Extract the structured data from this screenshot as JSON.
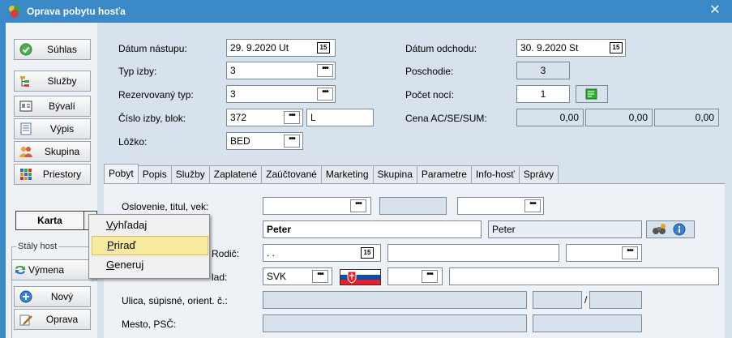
{
  "window": {
    "title": "Oprava pobytu hosťa",
    "close_glyph": "✕"
  },
  "left_buttons": {
    "suhlas": "Súhlas",
    "sluzby": "Služby",
    "byvali": "Bývalí",
    "vypis": "Výpis",
    "skupina": "Skupina",
    "priestory": "Priestory",
    "karta": "Karta",
    "staly_host": "Stály host",
    "vymena": "Výmena",
    "novy": "Nový",
    "oprava": "Oprava"
  },
  "form": {
    "datum_nastupu_label": "Dátum nástupu:",
    "datum_nastupu": "29. 9.2020  Ut",
    "datum_odchodu_label": "Dátum odchodu:",
    "datum_odchodu": "30. 9.2020  St",
    "typ_izby_label": "Typ izby:",
    "typ_izby": "3",
    "poschodie_label": "Poschodie:",
    "poschodie": "3",
    "rezervovany_typ_label": "Rezervovaný typ:",
    "rezervovany_typ": "3",
    "pocet_noci_label": "Počet nocí:",
    "pocet_noci": "1",
    "cislo_izby_label": "Číslo izby, blok:",
    "cislo_izby": "372",
    "blok": "L",
    "cena_label": "Cena AC/SE/SUM:",
    "cena_ac": "0,00",
    "cena_se": "0,00",
    "cena_sum": "0,00",
    "lozko_label": "Lôžko:",
    "lozko": "BED",
    "dots": "•••",
    "cal": "15"
  },
  "tabs": [
    "Pobyt",
    "Popis",
    "Služby",
    "Zaplatené",
    "Zaúčtované",
    "Marketing",
    "Skupina",
    "Parametre",
    "Info-hosť",
    "Správy"
  ],
  "pobyt": {
    "oslovenie_label": "Oslovenie, titul, vek:",
    "name1": "Peter",
    "name2": "Peter",
    "rodic_label_part": "Rodič:",
    "date_placeholder": ". .",
    "stat_label_part": "lad:",
    "stat": "SVK",
    "ulica_label": "Ulica, súpisné, orient. č.:",
    "ulica_sep": "/",
    "mesto_label": "Mesto, PSČ:"
  },
  "menu": {
    "items": [
      {
        "pre": "",
        "u": "V",
        "post": "yhľadaj"
      },
      {
        "pre": "",
        "u": "P",
        "post": "riraď"
      },
      {
        "pre": "",
        "u": "G",
        "post": "eneruj"
      }
    ]
  },
  "colors": {
    "title_bar": "#3c89c8",
    "highlight": "#f7eba0",
    "panel": "#d8e2ec"
  }
}
